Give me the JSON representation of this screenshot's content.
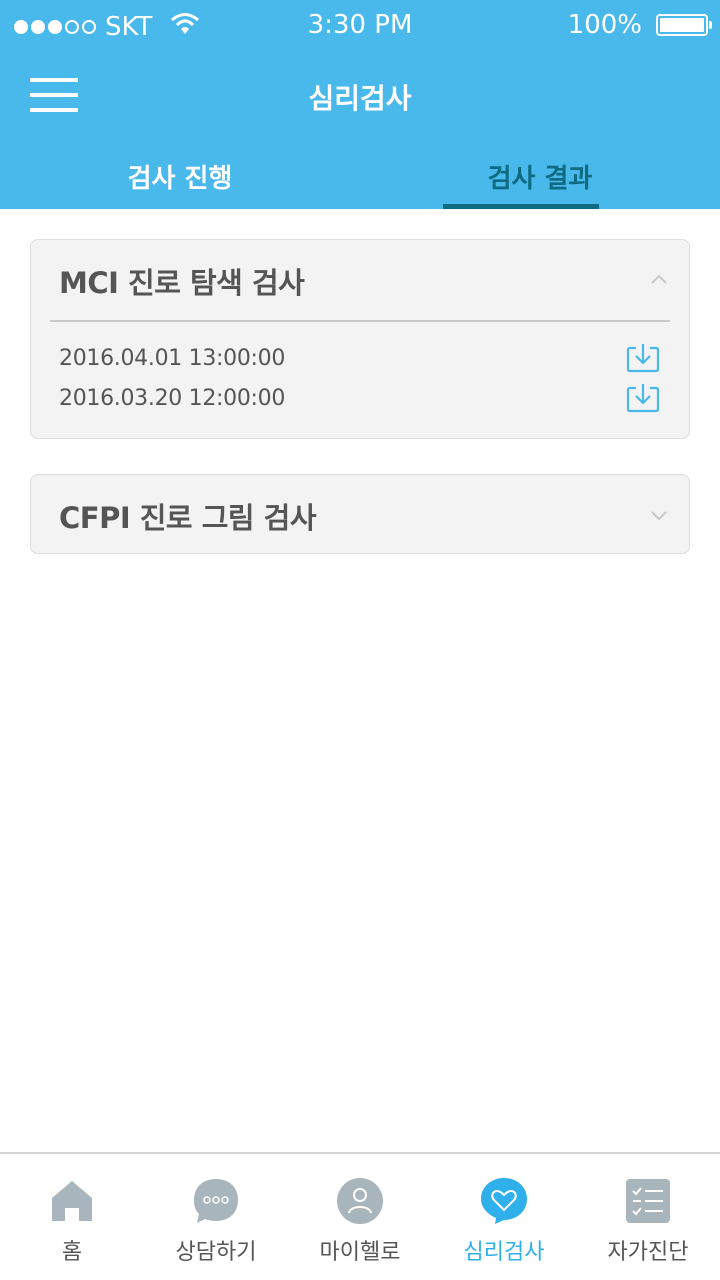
{
  "status_bar": {
    "carrier": "SKT",
    "time": "3:30 PM",
    "battery": "100%"
  },
  "header": {
    "title": "심리검사",
    "tabs": [
      {
        "label": "검사 진행"
      },
      {
        "label": "검사  결과"
      }
    ],
    "active_tab": "검사  결과"
  },
  "results": [
    {
      "title": "MCI 진로 탐색 검사",
      "expanded": true,
      "entries": [
        {
          "datetime": "2016.04.01  13:00:00"
        },
        {
          "datetime": "2016.03.20  12:00:00"
        }
      ]
    },
    {
      "title": "CFPI 진로 그림 검사",
      "expanded": false,
      "entries": []
    }
  ],
  "bottom_nav": {
    "items": [
      {
        "label": "홈",
        "icon": "home-icon"
      },
      {
        "label": "상담하기",
        "icon": "chat-icon"
      },
      {
        "label": "마이헬로",
        "icon": "user-icon"
      },
      {
        "label": "심리검사",
        "icon": "heart-icon"
      },
      {
        "label": "자가진단",
        "icon": "checklist-icon"
      }
    ],
    "active": "심리검사"
  },
  "colors": {
    "header": "#49b9ec",
    "active_tab": "#0e6b82",
    "accent": "#2fb0ea",
    "inactive_icon": "#a9b5bc"
  }
}
